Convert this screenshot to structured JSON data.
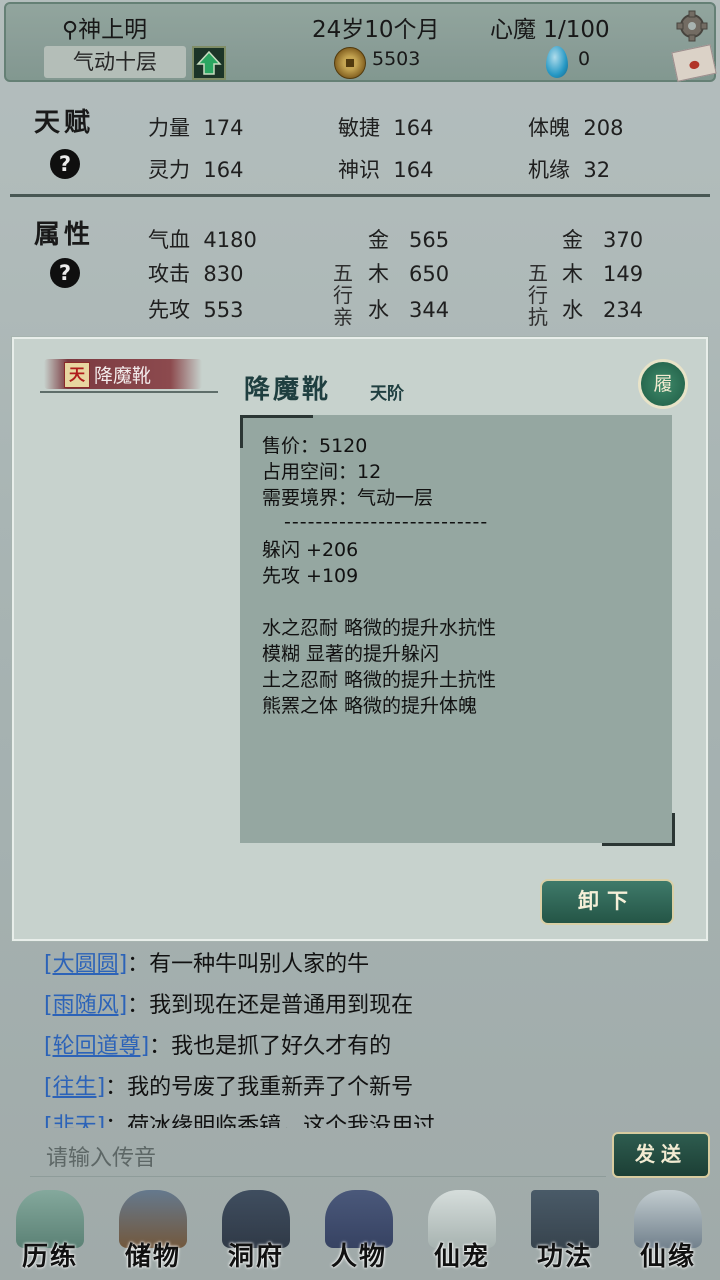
{
  "header": {
    "player_name": "神上明",
    "age": "24岁10个月",
    "heart_demon": "心魔  1/100",
    "realm": "气动十层",
    "coins": "5503",
    "gems": "0"
  },
  "talent": {
    "label": "天赋",
    "stats": [
      {
        "name": "力量",
        "value": "174"
      },
      {
        "name": "敏捷",
        "value": "164"
      },
      {
        "name": "体魄",
        "value": "208"
      },
      {
        "name": "灵力",
        "value": "164"
      },
      {
        "name": "神识",
        "value": "164"
      },
      {
        "name": "机缘",
        "value": "32"
      }
    ]
  },
  "attributes": {
    "label": "属性",
    "left": [
      {
        "name": "气血",
        "value": "4180"
      },
      {
        "name": "攻击",
        "value": "830"
      },
      {
        "name": "先攻",
        "value": "553"
      }
    ],
    "five_affinity_label": "五行亲",
    "five_resist_label": "五行抗",
    "affinity": [
      {
        "name": "金",
        "value": "565"
      },
      {
        "name": "木",
        "value": "650"
      },
      {
        "name": "水",
        "value": "344"
      }
    ],
    "resist": [
      {
        "name": "金",
        "value": "370"
      },
      {
        "name": "木",
        "value": "149"
      },
      {
        "name": "水",
        "value": "234"
      }
    ]
  },
  "item_modal": {
    "tab_label": "降魔靴",
    "tab_badge": "天",
    "title": "降魔靴",
    "grade": "天阶",
    "slot_char": "履",
    "lines": [
      "售价：5120",
      "占用空间：12",
      "需要境界：气动一层"
    ],
    "separator": "--------------------------",
    "bonuses": [
      "躲闪 +206",
      "先攻 +109"
    ],
    "traits": [
      "水之忍耐 略微的提升水抗性",
      "模糊 显著的提升躲闪",
      "土之忍耐 略微的提升土抗性",
      "熊罴之体 略微的提升体魄"
    ],
    "unequip_label": "卸下"
  },
  "chat": {
    "messages": [
      {
        "name": "[大圆圆]",
        "text": "：有一种牛叫别人家的牛"
      },
      {
        "name": "[雨随风]",
        "text": "：我到现在还是普通用到现在"
      },
      {
        "name": "[轮回道尊]",
        "text": "：我也是抓了好久才有的"
      },
      {
        "name": "[往生]",
        "text": "：我的号废了我重新弄了个新号"
      },
      {
        "name": "[非天]",
        "text": "：荷冰缘明临香镜，这个我没用过"
      }
    ],
    "placeholder": "请输入传音",
    "send_label": "发送"
  },
  "nav": {
    "items": [
      "历练",
      "储物",
      "洞府",
      "人物",
      "仙宠",
      "功法",
      "仙缘"
    ]
  }
}
